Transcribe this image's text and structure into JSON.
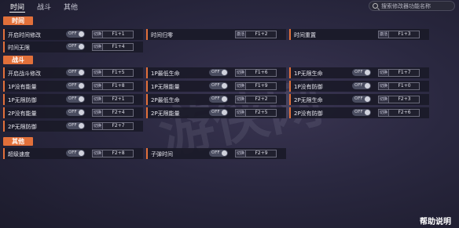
{
  "tabs": [
    "时间",
    "战斗",
    "其他"
  ],
  "search": {
    "placeholder": "搜索修改器功能名称"
  },
  "sections": {
    "time": "时间",
    "battle": "战斗",
    "other": "其他"
  },
  "toggle_text": "OFF",
  "switch_label": "切换",
  "activate_label": "激活",
  "time": {
    "r1": {
      "label": "开启时间修改",
      "key": "F1+1"
    },
    "r2": {
      "label": "时间归零",
      "key": "F1+2"
    },
    "r3": {
      "label": "时间重置",
      "key": "F1+3"
    },
    "r4": {
      "label": "时间无限",
      "key": "F1+4"
    }
  },
  "battle": {
    "c1": [
      {
        "label": "开启战斗修改",
        "key": "F1+5"
      },
      {
        "label": "1P没有能量",
        "key": "F1+8"
      },
      {
        "label": "1P无限防御",
        "key": "F2+1"
      },
      {
        "label": "2P没有能量",
        "key": "F2+4"
      },
      {
        "label": "2P无限防御",
        "key": "F2+7"
      }
    ],
    "c2": [
      {
        "label": "1P最低生命",
        "key": "F1+6"
      },
      {
        "label": "1P无限能量",
        "key": "F1+9"
      },
      {
        "label": "2P最低生命",
        "key": "F2+2"
      },
      {
        "label": "2P无限能量",
        "key": "F2+5"
      }
    ],
    "c3": [
      {
        "label": "1P无限生命",
        "key": "F1+7"
      },
      {
        "label": "1P没有防御",
        "key": "F1+0"
      },
      {
        "label": "2P无限生命",
        "key": "F2+3"
      },
      {
        "label": "2P没有防御",
        "key": "F2+6"
      }
    ]
  },
  "other": {
    "r1": {
      "label": "超级速度",
      "key": "F2+8"
    },
    "r2": {
      "label": "子弹时间",
      "key": "F2+9"
    }
  },
  "help": "帮助说明"
}
